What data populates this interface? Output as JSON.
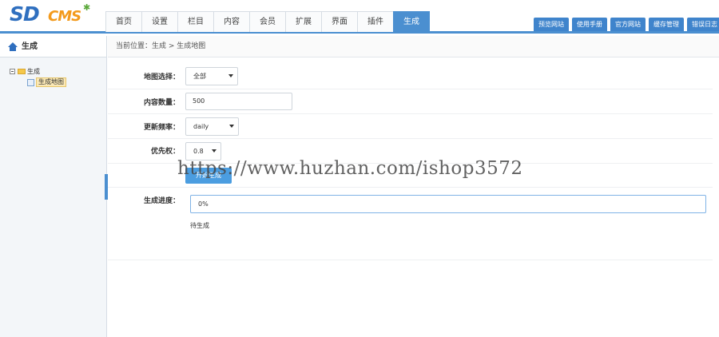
{
  "logo": {
    "primary": "SD",
    "secondary": "CMS"
  },
  "nav": {
    "items": [
      {
        "label": "首页",
        "active": false
      },
      {
        "label": "设置",
        "active": false
      },
      {
        "label": "栏目",
        "active": false
      },
      {
        "label": "内容",
        "active": false
      },
      {
        "label": "会员",
        "active": false
      },
      {
        "label": "扩展",
        "active": false
      },
      {
        "label": "界面",
        "active": false
      },
      {
        "label": "插件",
        "active": false
      },
      {
        "label": "生成",
        "active": true
      }
    ]
  },
  "top_buttons": [
    "预览网站",
    "使用手册",
    "官方网站",
    "缓存管理",
    "错误日志"
  ],
  "sidebar": {
    "title": "生成",
    "tree": {
      "root": "生成",
      "child": "生成地图"
    }
  },
  "breadcrumb": "当前位置：生成 > 生成地图",
  "form": {
    "map_select": {
      "label": "地图选择：",
      "value": "全部"
    },
    "content_count": {
      "label": "内容数量：",
      "value": "500"
    },
    "update_freq": {
      "label": "更新频率：",
      "value": "daily"
    },
    "priority": {
      "label": "优先权：",
      "value": "0.8"
    },
    "start_button": "开始生成",
    "progress": {
      "label": "生成进度：",
      "value": "0%"
    },
    "status": "待生成"
  },
  "watermark": "https://www.huzhan.com/ishop3572",
  "colors": {
    "accent": "#4b8fd0",
    "logo_blue": "#2f6fbf",
    "logo_orange": "#f39a1c"
  }
}
